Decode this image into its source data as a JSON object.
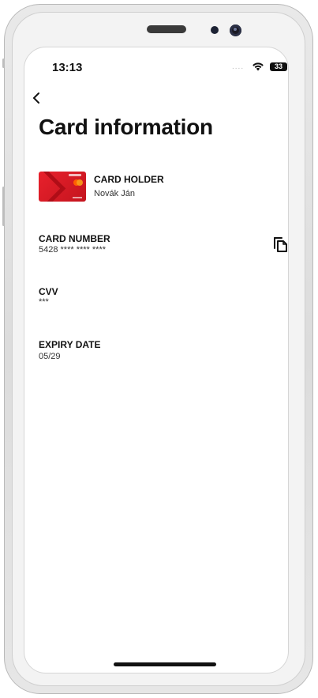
{
  "status_bar": {
    "time": "13:13",
    "signal_dots": "....",
    "battery_level": "33"
  },
  "header": {
    "title": "Card information"
  },
  "card_holder": {
    "label": "CARD HOLDER",
    "value": "Novák Ján"
  },
  "card_number": {
    "label": "CARD NUMBER",
    "value": "5428 **** **** ****"
  },
  "cvv": {
    "label": "CVV",
    "value": "***"
  },
  "expiry_date": {
    "label": "EXPIRY DATE",
    "value": "05/29"
  },
  "icons": {
    "back": "chevron-left-icon",
    "copy": "copy-icon",
    "wifi": "wifi-icon",
    "battery": "battery-icon"
  },
  "colors": {
    "card_red": "#e8212c",
    "text_primary": "#111111",
    "background": "#ffffff"
  }
}
